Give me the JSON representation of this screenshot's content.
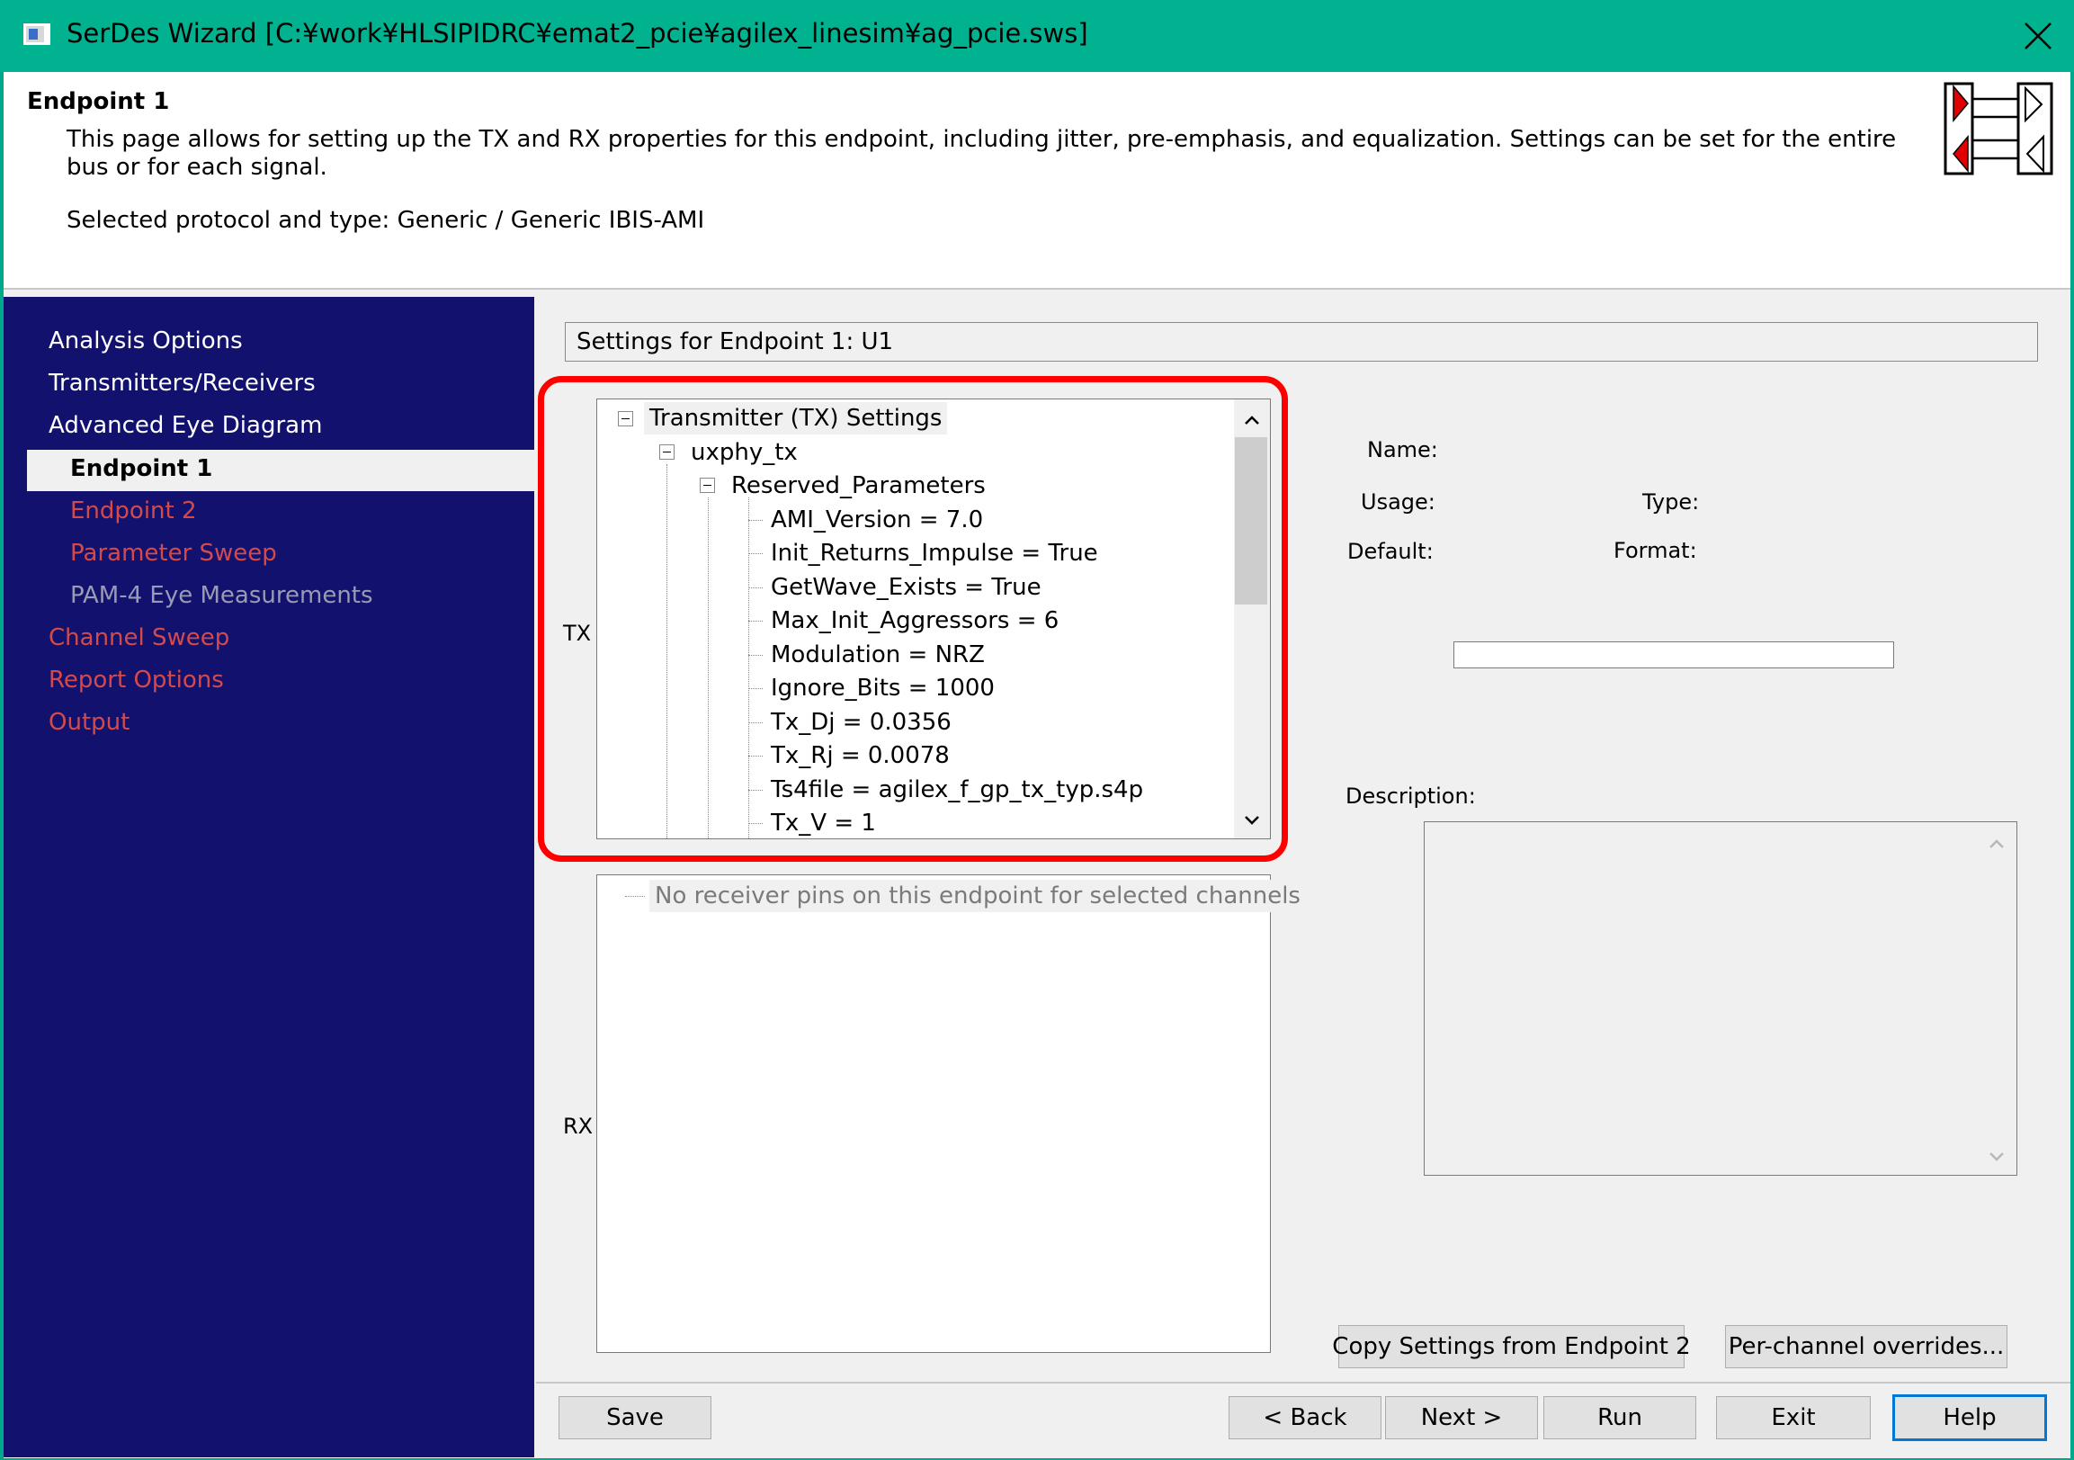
{
  "window": {
    "title": "SerDes Wizard [C:¥work¥HLSIPIDRC¥emat2_pcie¥agilex_linesim¥ag_pcie.sws]"
  },
  "header": {
    "title": "Endpoint 1",
    "description": "This page allows for setting up the TX and RX properties for this endpoint, including jitter, pre-emphasis, and equalization.  Settings can be set for the entire bus or for each signal.",
    "protocol": "Selected protocol and type: Generic / Generic IBIS-AMI"
  },
  "sidebar": {
    "items": [
      {
        "label": "Analysis Options"
      },
      {
        "label": "Transmitters/Receivers"
      },
      {
        "label": "Advanced Eye Diagram"
      },
      {
        "label": "Endpoint 1"
      },
      {
        "label": "Endpoint 2"
      },
      {
        "label": "Parameter Sweep"
      },
      {
        "label": "PAM-4 Eye Measurements"
      },
      {
        "label": "Channel Sweep"
      },
      {
        "label": "Report Options"
      },
      {
        "label": "Output"
      }
    ]
  },
  "main": {
    "settings_label": "Settings for Endpoint 1: U1",
    "tx_label": "TX",
    "rx_label": "RX",
    "tx_tree": {
      "root": "Transmitter (TX) Settings",
      "model": "uxphy_tx",
      "group": "Reserved_Parameters",
      "params": [
        "AMI_Version = 7.0",
        "Init_Returns_Impulse = True",
        "GetWave_Exists = True",
        "Max_Init_Aggressors = 6",
        "Modulation = NRZ",
        "Ignore_Bits = 1000",
        "Tx_Dj = 0.0356",
        "Tx_Rj = 0.0078",
        "Ts4file = agilex_f_gp_tx_typ.s4p",
        "Tx_V = 1"
      ]
    },
    "rx_tree": {
      "message": "No receiver pins on this endpoint for selected channels"
    },
    "properties": {
      "name_label": "Name:",
      "usage_label": "Usage:",
      "type_label": "Type:",
      "default_label": "Default:",
      "format_label": "Format:",
      "description_label": "Description:",
      "value": ""
    }
  },
  "buttons": {
    "copy": "Copy Settings from Endpoint 2",
    "overrides": "Per-channel overrides...",
    "save": "Save",
    "back": "< Back",
    "next": "Next >",
    "run": "Run",
    "exit": "Exit",
    "help": "Help"
  },
  "colors": {
    "titlebar": "#00b28f",
    "sidebar": "#12126e",
    "highlight": "#ff0000",
    "nav_disabled": "#d44a4a"
  }
}
